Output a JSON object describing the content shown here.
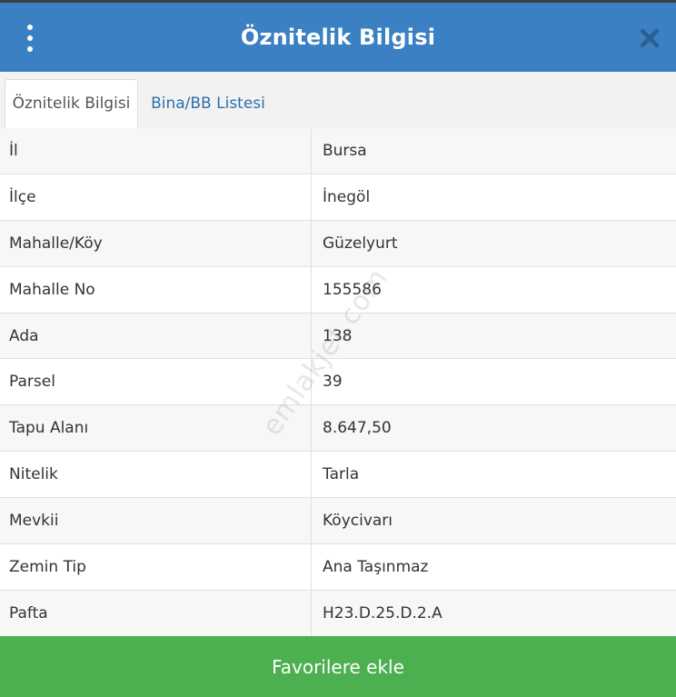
{
  "header": {
    "title": "Öznitelik Bilgisi",
    "menu_icon": "vertical-dots-icon",
    "close_icon": "close-icon"
  },
  "tabs": [
    {
      "label": "Öznitelik Bilgisi",
      "active": true
    },
    {
      "label": "Bina/BB Listesi",
      "active": false
    }
  ],
  "rows": [
    {
      "label": "İl",
      "value": "Bursa"
    },
    {
      "label": "İlçe",
      "value": "İnegöl"
    },
    {
      "label": "Mahalle/Köy",
      "value": "Güzelyurt"
    },
    {
      "label": "Mahalle No",
      "value": "155586"
    },
    {
      "label": "Ada",
      "value": "138"
    },
    {
      "label": "Parsel",
      "value": "39"
    },
    {
      "label": "Tapu Alanı",
      "value": "8.647,50"
    },
    {
      "label": "Nitelik",
      "value": "Tarla"
    },
    {
      "label": "Mevkii",
      "value": "Köycivarı"
    },
    {
      "label": "Zemin Tip",
      "value": "Ana Taşınmaz"
    },
    {
      "label": "Pafta",
      "value": "H23.D.25.D.2.A"
    }
  ],
  "watermark": "emlakjet.com",
  "footer": {
    "button_label": "Favorilere ekle"
  },
  "colors": {
    "header_bg": "#3b80c2",
    "button_bg": "#4caf50",
    "tab_link": "#2f6fa8"
  }
}
